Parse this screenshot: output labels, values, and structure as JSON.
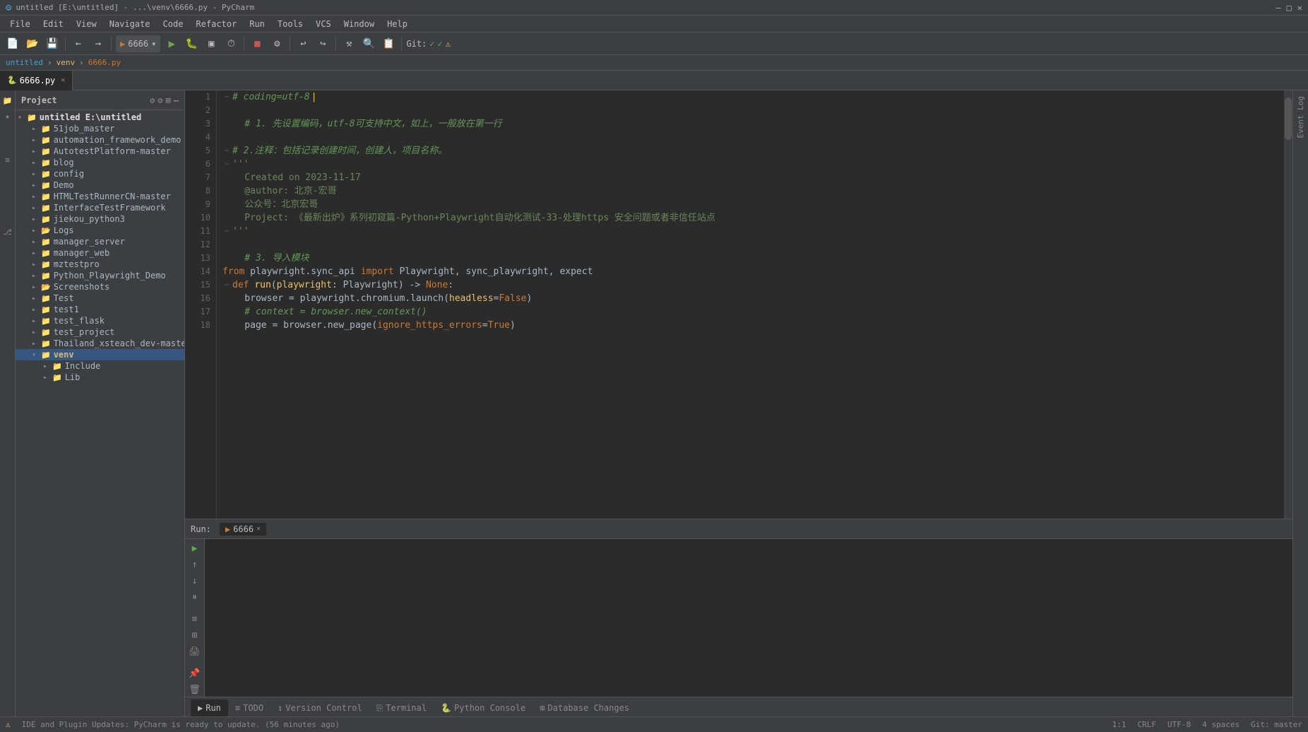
{
  "titleBar": {
    "title": "untitled [E:\\untitled] - ...\\venv\\6666.py - PyCharm",
    "minimize": "—",
    "maximize": "□",
    "close": "✕"
  },
  "menuBar": {
    "items": [
      "File",
      "Edit",
      "View",
      "Navigate",
      "Code",
      "Refactor",
      "Run",
      "Tools",
      "VCS",
      "Window",
      "Help"
    ]
  },
  "toolbar": {
    "runConfig": "6666",
    "gitLabel": "Git:",
    "gitStatus": "✓"
  },
  "tabs": {
    "active": "6666.py",
    "items": [
      {
        "label": "6666.py",
        "active": true
      }
    ]
  },
  "breadcrumb": {
    "path": "untitled > venv > 6666.py"
  },
  "project": {
    "title": "Project",
    "root": "untitled E:\\untitled",
    "items": [
      {
        "label": "51job_master",
        "type": "folder",
        "indent": 1,
        "expanded": false
      },
      {
        "label": "automation_framework_demo",
        "type": "folder",
        "indent": 1,
        "expanded": false
      },
      {
        "label": "AutotestPlatform-master",
        "type": "folder",
        "indent": 1,
        "expanded": false
      },
      {
        "label": "blog",
        "type": "folder",
        "indent": 1,
        "expanded": false
      },
      {
        "label": "config",
        "type": "folder",
        "indent": 1,
        "expanded": false
      },
      {
        "label": "Demo",
        "type": "folder",
        "indent": 1,
        "expanded": false
      },
      {
        "label": "HTMLTestRunnerCN-master",
        "type": "folder",
        "indent": 1,
        "expanded": false
      },
      {
        "label": "InterfaceTestFramework",
        "type": "folder",
        "indent": 1,
        "expanded": false
      },
      {
        "label": "jiekou_python3",
        "type": "folder",
        "indent": 1,
        "expanded": false
      },
      {
        "label": "Logs",
        "type": "folder",
        "indent": 1,
        "expanded": false
      },
      {
        "label": "manager_server",
        "type": "folder",
        "indent": 1,
        "expanded": false
      },
      {
        "label": "manager_web",
        "type": "folder",
        "indent": 1,
        "expanded": false
      },
      {
        "label": "mztestpro",
        "type": "folder",
        "indent": 1,
        "expanded": false
      },
      {
        "label": "Python_Playwright_Demo",
        "type": "folder",
        "indent": 1,
        "expanded": false
      },
      {
        "label": "Screenshots",
        "type": "folder",
        "indent": 1,
        "expanded": false
      },
      {
        "label": "Test",
        "type": "folder",
        "indent": 1,
        "expanded": false
      },
      {
        "label": "test1",
        "type": "folder",
        "indent": 1,
        "expanded": false
      },
      {
        "label": "test_flask",
        "type": "folder",
        "indent": 1,
        "expanded": false
      },
      {
        "label": "test_project",
        "type": "folder",
        "indent": 1,
        "expanded": false
      },
      {
        "label": "Thailand_xsteach_dev-master",
        "type": "folder",
        "indent": 1,
        "expanded": false
      },
      {
        "label": "venv",
        "type": "venv-folder",
        "indent": 1,
        "expanded": true
      },
      {
        "label": "Include",
        "type": "folder",
        "indent": 2,
        "expanded": false
      },
      {
        "label": "Lib",
        "type": "folder",
        "indent": 2,
        "expanded": false
      }
    ]
  },
  "codeLines": [
    {
      "num": 1,
      "code": "# coding=utf-8",
      "type": "comment-coding"
    },
    {
      "num": 2,
      "code": "",
      "type": "empty"
    },
    {
      "num": 3,
      "code": "# 1. 先设置编码，utf-8可支持中文，如上，一般放在第一行",
      "type": "comment"
    },
    {
      "num": 4,
      "code": "",
      "type": "empty"
    },
    {
      "num": 5,
      "code": "# 2.注释：包括记录创建时间，创建人，项目名称。",
      "type": "comment-fold"
    },
    {
      "num": 6,
      "code": "'''",
      "type": "docstring-start"
    },
    {
      "num": 7,
      "code": "    Created on 2023-11-17",
      "type": "docstring"
    },
    {
      "num": 8,
      "code": "    @author: 北京-宏哥",
      "type": "docstring"
    },
    {
      "num": 9,
      "code": "    公众号：北京宏哥",
      "type": "docstring"
    },
    {
      "num": 10,
      "code": "    Project: 《最新出炉》系列初窥篇-Python+Playwright自动化测试-33-处理https 安全问题或者非信任站点",
      "type": "docstring"
    },
    {
      "num": 11,
      "code": "'''",
      "type": "docstring-end"
    },
    {
      "num": 12,
      "code": "",
      "type": "empty"
    },
    {
      "num": 13,
      "code": "# 3. 导入模块",
      "type": "comment"
    },
    {
      "num": 14,
      "code": "from playwright.sync_api import Playwright, sync_playwright, expect",
      "type": "import"
    },
    {
      "num": 15,
      "code": "def run(playwright: Playwright) -> None:",
      "type": "def"
    },
    {
      "num": 16,
      "code": "    browser = playwright.chromium.launch(headless=False)",
      "type": "code"
    },
    {
      "num": 17,
      "code": "    # context = browser.new_context()",
      "type": "comment-inline"
    },
    {
      "num": 18,
      "code": "    page = browser.new_page(ignore_https_errors=True)",
      "type": "code"
    }
  ],
  "runPanel": {
    "label": "Run:",
    "tab": "6666",
    "tabClose": "✕"
  },
  "bottomTabs": [
    {
      "label": "▶ Run",
      "active": true,
      "icon": "run"
    },
    {
      "label": "≡ TODO",
      "active": false,
      "icon": "todo"
    },
    {
      "label": "↕ Version Control",
      "active": false,
      "icon": "vcs"
    },
    {
      "label": "⎘ Terminal",
      "active": false,
      "icon": "terminal"
    },
    {
      "label": "Python Console",
      "active": false,
      "icon": "python-console"
    },
    {
      "label": "⊞ Database Changes",
      "active": false,
      "icon": "database"
    }
  ],
  "statusBar": {
    "message": "IDE and Plugin Updates: PyCharm is ready to update. (56 minutes ago)",
    "position": "1:1",
    "lineEnding": "CRLF",
    "encoding": "UTF-8",
    "indent": "4 spaces",
    "gitBranch": "Git: master"
  }
}
